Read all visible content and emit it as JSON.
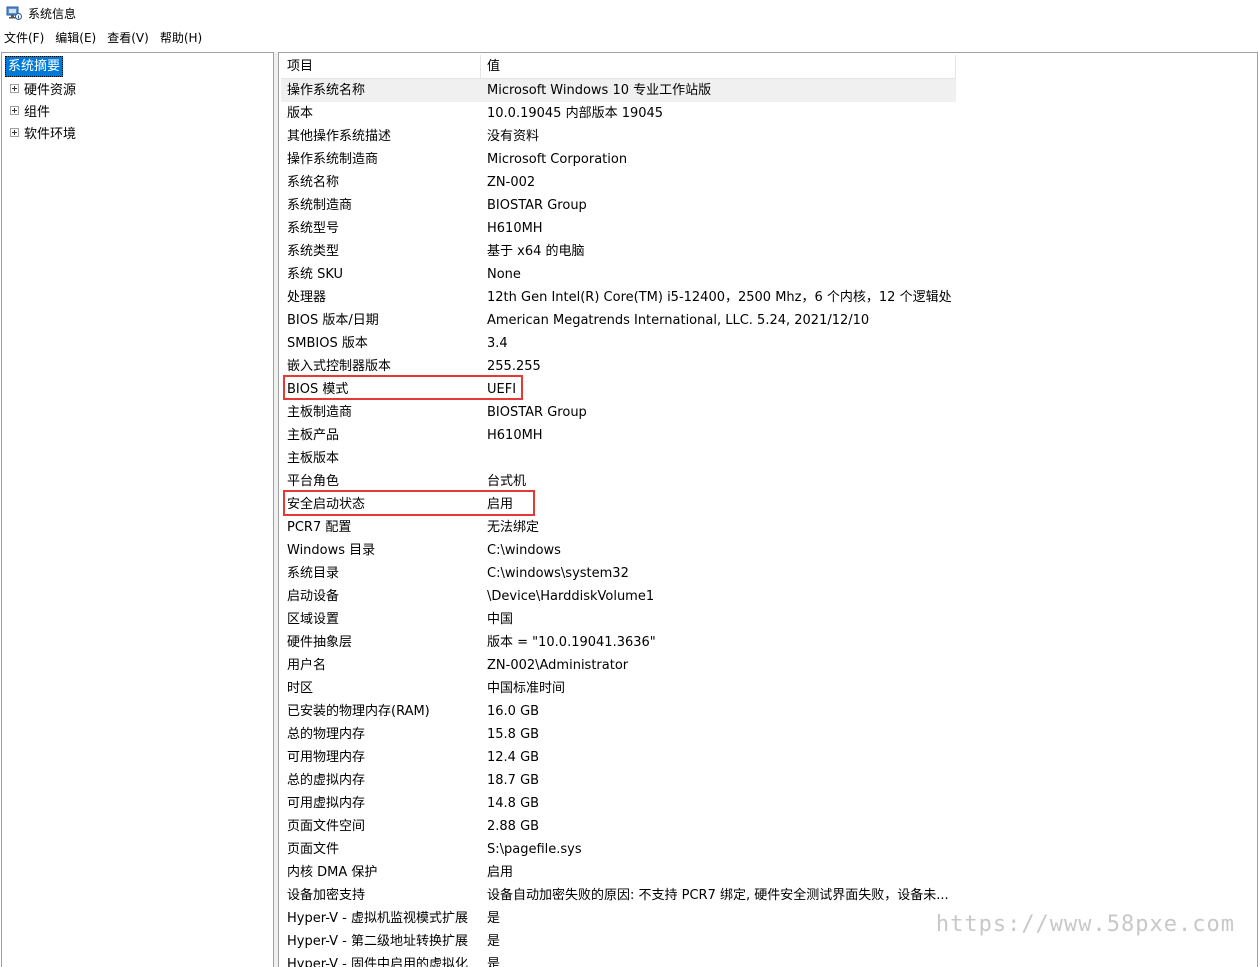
{
  "window": {
    "title": "系统信息",
    "icon": "system-info-icon"
  },
  "menu": [
    "文件(F)",
    "编辑(E)",
    "查看(V)",
    "帮助(H)"
  ],
  "tree": {
    "root": "系统摘要",
    "children": [
      "硬件资源",
      "组件",
      "软件环境"
    ]
  },
  "table": {
    "headers": [
      "项目",
      "值"
    ],
    "rows": [
      [
        "操作系统名称",
        "Microsoft Windows 10 专业工作站版"
      ],
      [
        "版本",
        "10.0.19045 内部版本 19045"
      ],
      [
        "其他操作系统描述",
        "没有资料"
      ],
      [
        "操作系统制造商",
        "Microsoft Corporation"
      ],
      [
        "系统名称",
        "ZN-002"
      ],
      [
        "系统制造商",
        "BIOSTAR Group"
      ],
      [
        "系统型号",
        "H610MH"
      ],
      [
        "系统类型",
        "基于 x64 的电脑"
      ],
      [
        "系统 SKU",
        "None"
      ],
      [
        "处理器",
        "12th Gen Intel(R) Core(TM) i5-12400，2500 Mhz，6 个内核，12 个逻辑处..."
      ],
      [
        "BIOS 版本/日期",
        "American Megatrends International, LLC. 5.24, 2021/12/10"
      ],
      [
        "SMBIOS 版本",
        "3.4"
      ],
      [
        "嵌入式控制器版本",
        "255.255"
      ],
      [
        "BIOS 模式",
        "UEFI"
      ],
      [
        "主板制造商",
        "BIOSTAR Group"
      ],
      [
        "主板产品",
        "H610MH"
      ],
      [
        "主板版本",
        ""
      ],
      [
        "平台角色",
        "台式机"
      ],
      [
        "安全启动状态",
        "启用"
      ],
      [
        "PCR7 配置",
        "无法绑定"
      ],
      [
        "Windows 目录",
        "C:\\windows"
      ],
      [
        "系统目录",
        "C:\\windows\\system32"
      ],
      [
        "启动设备",
        "\\Device\\HarddiskVolume1"
      ],
      [
        "区域设置",
        "中国"
      ],
      [
        "硬件抽象层",
        "版本 = \"10.0.19041.3636\""
      ],
      [
        "用户名",
        "ZN-002\\Administrator"
      ],
      [
        "时区",
        "中国标准时间"
      ],
      [
        "已安装的物理内存(RAM)",
        "16.0 GB"
      ],
      [
        "总的物理内存",
        "15.8 GB"
      ],
      [
        "可用物理内存",
        "12.4 GB"
      ],
      [
        "总的虚拟内存",
        "18.7 GB"
      ],
      [
        "可用虚拟内存",
        "14.8 GB"
      ],
      [
        "页面文件空间",
        "2.88 GB"
      ],
      [
        "页面文件",
        "S:\\pagefile.sys"
      ],
      [
        "内核 DMA 保护",
        "启用"
      ],
      [
        "设备加密支持",
        "设备自动加密失败的原因: 不支持 PCR7 绑定, 硬件安全测试界面失败，设备未..."
      ],
      [
        "Hyper-V - 虚拟机监视模式扩展",
        "是"
      ],
      [
        "Hyper-V - 第二级地址转换扩展",
        "是"
      ],
      [
        "Hyper-V - 固件中启用的虚拟化",
        "是"
      ]
    ]
  },
  "colors": {
    "selection": "#0078d7",
    "highlight": "#e53935",
    "row_selected": "#f0f0f0"
  },
  "watermark": "https://www.58pxe.com"
}
